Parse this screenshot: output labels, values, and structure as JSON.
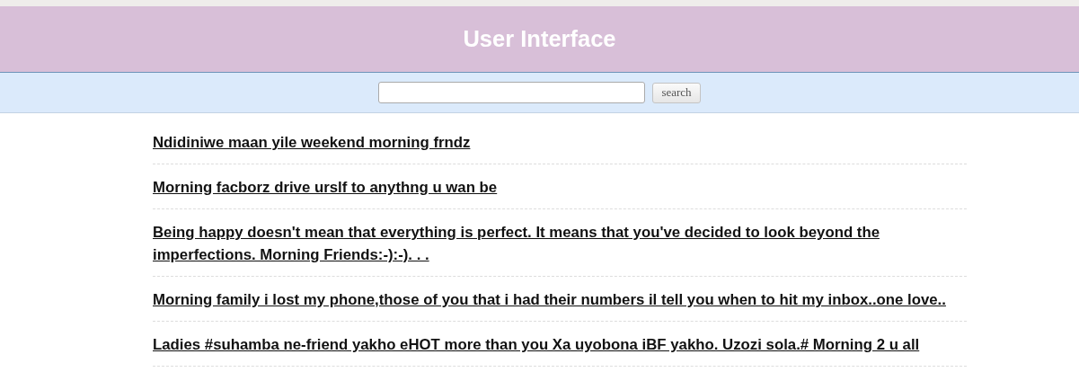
{
  "header": {
    "title": "User Interface"
  },
  "search": {
    "button": "search"
  },
  "posts": [
    {
      "text": "Ndidiniwe maan yile weekend morning frndz"
    },
    {
      "text": "Morning facborz drive urslf to anythng u wan be"
    },
    {
      "text": "Being happy doesn't mean that everything is perfect. It means that you've decided to look beyond the imperfections. Morning Friends:-):-). . ."
    },
    {
      "text": "Morning family i lost my phone,those of you that i had their numbers il tell you when to hit my inbox..one love.."
    },
    {
      "text": "Ladies #suhamba ne-friend yakho eHOT more than you Xa uyobona iBF yakho. Uzozi sola.# Morning 2 u all"
    }
  ]
}
